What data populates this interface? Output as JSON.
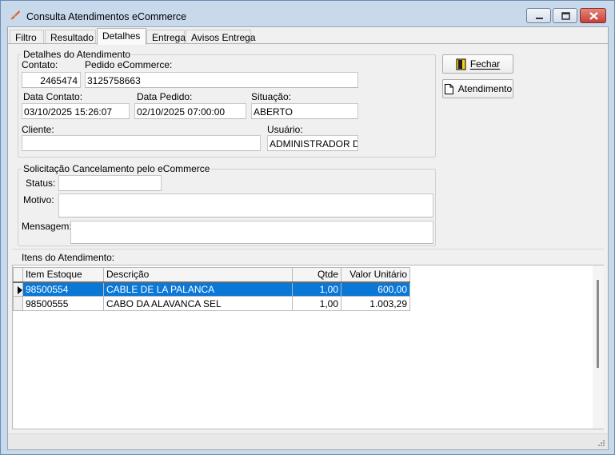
{
  "window": {
    "title": "Consulta Atendimentos eCommerce",
    "icon": "app-logo-icon",
    "controls": [
      "minimize-icon",
      "maximize-icon",
      "close-icon"
    ]
  },
  "tabs": [
    {
      "label": "Filtro",
      "active": false
    },
    {
      "label": "Resultado",
      "active": false
    },
    {
      "label": "Detalhes",
      "active": true
    },
    {
      "label": "Entrega",
      "active": false
    },
    {
      "label": "Avisos Entrega",
      "active": false
    }
  ],
  "details": {
    "group_label": "Detalhes do Atendimento",
    "contato_label": "Contato:",
    "contato_value": "2465474",
    "pedido_label": "Pedido eCommerce:",
    "pedido_value": "3125758663",
    "data_contato_label": "Data Contato:",
    "data_contato_value": "03/10/2025 15:26:07",
    "data_pedido_label": "Data Pedido:",
    "data_pedido_value": "02/10/2025 07:00:00",
    "situacao_label": "Situação:",
    "situacao_value": "ABERTO",
    "cliente_label": "Cliente:",
    "cliente_value": "",
    "usuario_label": "Usuário:",
    "usuario_value": "ADMINISTRADOR DO S"
  },
  "cancel": {
    "group_label": "Solicitação Cancelamento pelo eCommerce",
    "status_label": "Status:",
    "status_value": "",
    "motivo_label": "Motivo:",
    "motivo_value": "",
    "mensagem_label": "Mensagem:",
    "mensagem_value": ""
  },
  "buttons": {
    "fechar_label": "Fechar",
    "atendimento_label": "Atendimento"
  },
  "items": {
    "section_label": "Itens do Atendimento:",
    "columns": [
      "Item Estoque",
      "Descrição",
      "Qtde",
      "Valor Unitário"
    ],
    "rows": [
      {
        "item": "98500554",
        "descricao": "CABLE DE LA PALANCA",
        "qtde": "1,00",
        "valor": "600,00",
        "selected": true
      },
      {
        "item": "98500555",
        "descricao": "CABO DA ALAVANCA SEL",
        "qtde": "1,00",
        "valor": "1.003,29",
        "selected": false
      }
    ]
  },
  "colors": {
    "selection": "#0a78d7",
    "frame": "#c8d9ec",
    "close_button": "#c6403a"
  }
}
